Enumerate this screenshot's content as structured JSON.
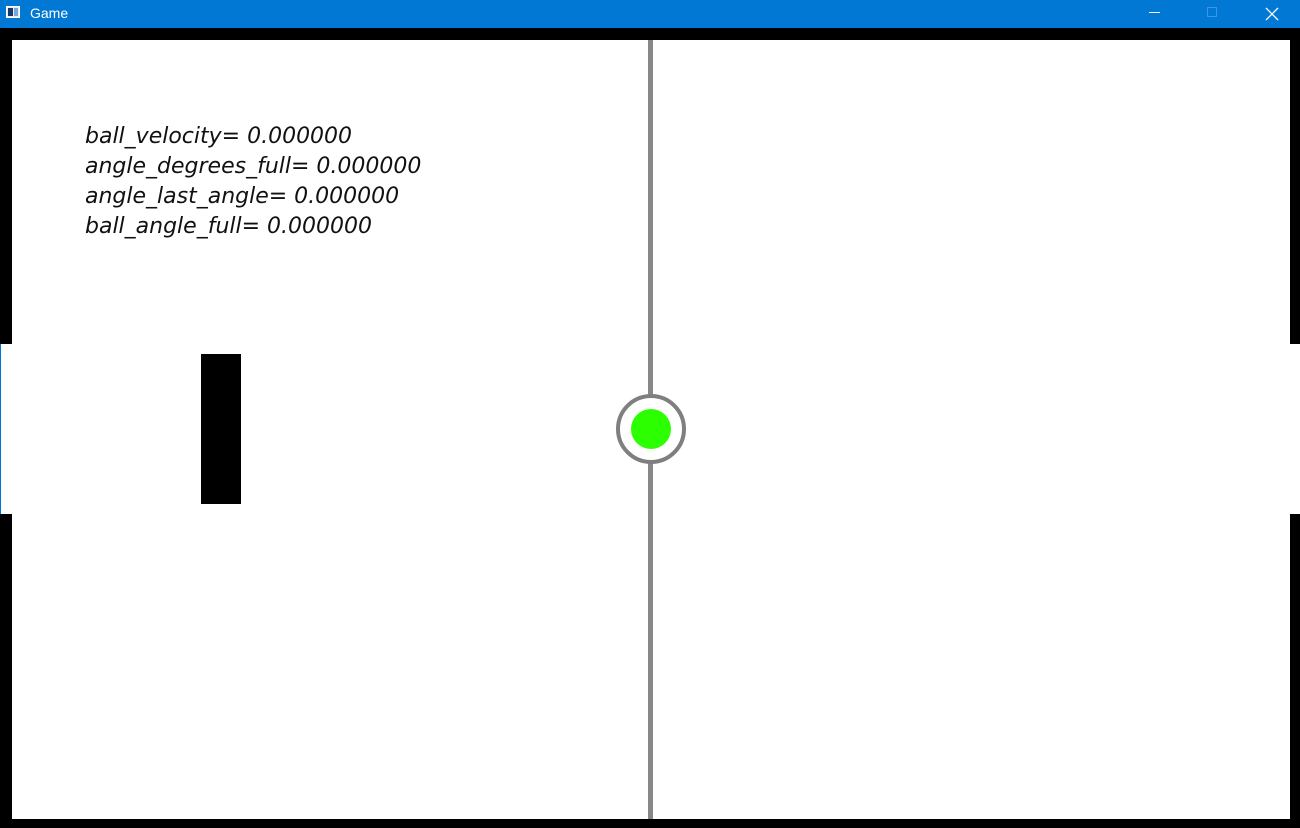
{
  "window": {
    "title": "Game",
    "icons": {
      "app": "app-icon",
      "minimize": "minimize-icon",
      "maximize": "maximize-icon",
      "close": "close-icon"
    },
    "colors": {
      "titlebar": "#0078d4"
    }
  },
  "game": {
    "colors": {
      "field": "#ffffff",
      "border": "#000000",
      "center_line": "#888888",
      "ball": "#2bff00",
      "paddle": "#000000"
    },
    "debug_lines": [
      "ball_velocity= 0.000000",
      "angle_degrees_full= 0.000000",
      "angle_last_angle= 0.000000",
      "ball_angle_full= 0.000000"
    ]
  }
}
